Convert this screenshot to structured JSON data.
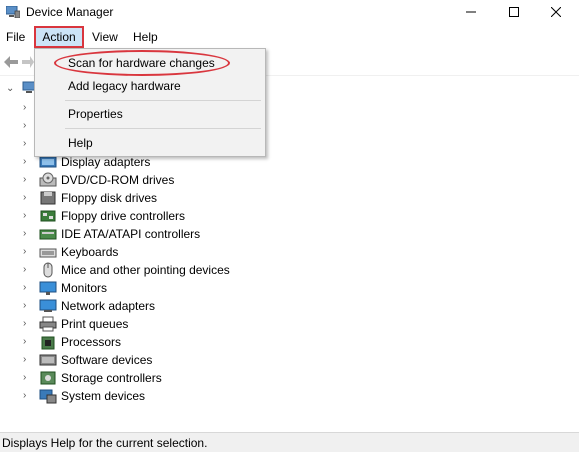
{
  "window": {
    "title": "Device Manager",
    "icon": "device-manager-icon",
    "controls": [
      "minimize-icon",
      "maximize-icon",
      "close-icon"
    ]
  },
  "menubar": {
    "items": [
      {
        "label": "File"
      },
      {
        "label": "Action",
        "active": true
      },
      {
        "label": "View"
      },
      {
        "label": "Help"
      }
    ]
  },
  "toolbar": {
    "icons": [
      "back-arrow-icon",
      "forward-arrow-icon"
    ]
  },
  "action_menu": {
    "items": [
      {
        "label": "Scan for hardware changes",
        "highlighted": true
      },
      {
        "label": "Add legacy hardware"
      },
      {
        "label": "Properties"
      },
      {
        "label": "Help"
      }
    ]
  },
  "tree": {
    "categories": [
      {
        "label": "Display adapters",
        "icon": "display-adapter-icon"
      },
      {
        "label": "DVD/CD-ROM drives",
        "icon": "dvd-drive-icon"
      },
      {
        "label": "Floppy disk drives",
        "icon": "floppy-disk-icon"
      },
      {
        "label": "Floppy drive controllers",
        "icon": "floppy-controller-icon"
      },
      {
        "label": "IDE ATA/ATAPI controllers",
        "icon": "ide-controller-icon"
      },
      {
        "label": "Keyboards",
        "icon": "keyboard-icon"
      },
      {
        "label": "Mice and other pointing devices",
        "icon": "mouse-icon"
      },
      {
        "label": "Monitors",
        "icon": "monitor-icon"
      },
      {
        "label": "Network adapters",
        "icon": "network-adapter-icon"
      },
      {
        "label": "Print queues",
        "icon": "printer-icon"
      },
      {
        "label": "Processors",
        "icon": "processor-icon"
      },
      {
        "label": "Software devices",
        "icon": "software-device-icon"
      },
      {
        "label": "Storage controllers",
        "icon": "storage-controller-icon"
      },
      {
        "label": "System devices",
        "icon": "system-devices-icon"
      }
    ]
  },
  "statusbar": {
    "text": "Displays Help for the current selection."
  },
  "colors": {
    "highlight_red": "#d9363e",
    "menu_active_bg": "#cce4f7",
    "dropdown_bg": "#f2f2f2"
  }
}
